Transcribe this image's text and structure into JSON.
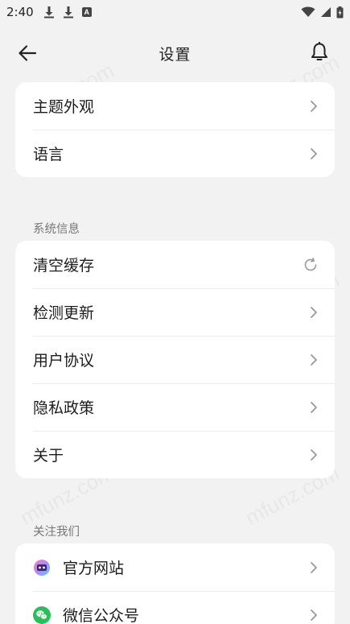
{
  "status_bar": {
    "time": "2:40"
  },
  "header": {
    "title": "设置"
  },
  "group_general": {
    "items": [
      {
        "label": "主题外观"
      },
      {
        "label": "语言"
      }
    ]
  },
  "group_system": {
    "title": "系统信息",
    "items": [
      {
        "label": "清空缓存"
      },
      {
        "label": "检测更新"
      },
      {
        "label": "用户协议"
      },
      {
        "label": "隐私政策"
      },
      {
        "label": "关于"
      }
    ]
  },
  "group_follow": {
    "title": "关注我们",
    "items": [
      {
        "label": "官方网站"
      },
      {
        "label": "微信公众号"
      }
    ]
  },
  "colors": {
    "background": "#f2f2f2",
    "card": "#ffffff",
    "wechat_green": "#29c05a"
  }
}
